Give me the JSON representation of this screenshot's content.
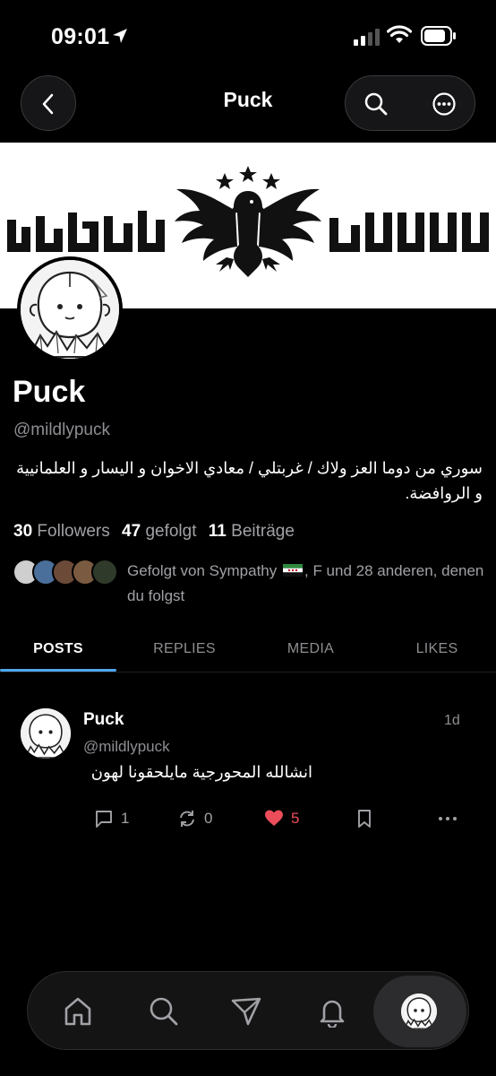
{
  "status": {
    "time": "09:01"
  },
  "nav": {
    "title": "Puck"
  },
  "profile": {
    "name": "Puck",
    "handle": "@mildlypuck",
    "bio": "سوري من دوما العز ولاك / غربتلي / معادي الاخوان و اليسار و العلمانيية و الروافضة."
  },
  "stats": {
    "followers_count": "30",
    "followers_label": "Followers",
    "following_count": "47",
    "following_label": "gefolgt",
    "posts_count": "11",
    "posts_label": "Beiträge"
  },
  "followed_by": {
    "prefix": "Gefolgt von Sympathy",
    "suffix": ", F und 28 anderen, denen du folgst"
  },
  "tabs": [
    {
      "label": "POSTS",
      "active": true
    },
    {
      "label": "REPLIES",
      "active": false
    },
    {
      "label": "MEDIA",
      "active": false
    },
    {
      "label": "LIKES",
      "active": false
    }
  ],
  "post": {
    "name": "Puck",
    "handle": "@mildlypuck",
    "time": "1d",
    "text": "انشالله المحورجية مايلحقونا لهون",
    "replies": "1",
    "reposts": "0",
    "likes": "5"
  },
  "colors": {
    "accent": "#4fa7ee",
    "like": "#ec4d5a",
    "secondary_text": "#8e8e93"
  },
  "icons": [
    "back-icon",
    "search-icon",
    "more-icon",
    "reply-icon",
    "repost-icon",
    "heart-icon",
    "bookmark-icon",
    "home-icon",
    "explore-icon",
    "send-icon",
    "bell-icon"
  ]
}
